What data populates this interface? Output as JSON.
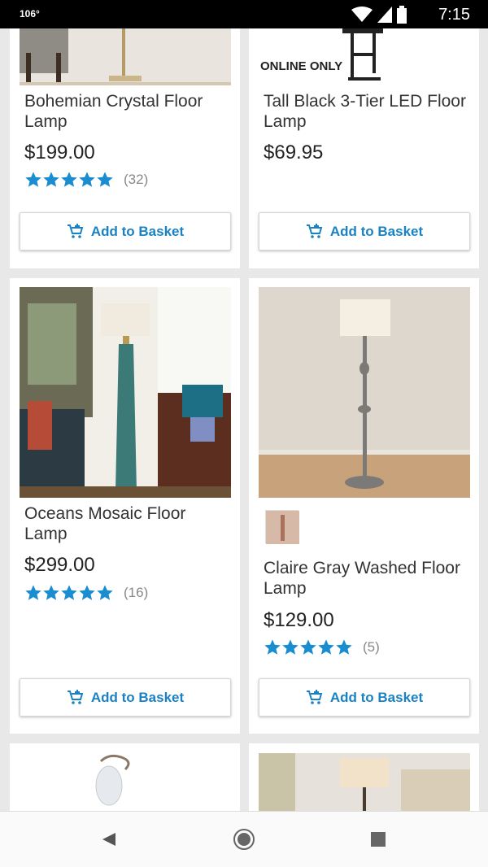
{
  "status": {
    "temp": "106°",
    "time": "7:15"
  },
  "online_label": "ONLINE ONLY",
  "add_label": "Add to Basket",
  "products": [
    {
      "title": "Bohemian Crystal Floor Lamp",
      "price": "$199.00",
      "reviews": "(32)",
      "rating": 5
    },
    {
      "title": "Tall Black 3-Tier LED Floor Lamp",
      "price": "$69.95",
      "reviews": "",
      "rating": 0
    },
    {
      "title": "Oceans Mosaic Floor Lamp",
      "price": "$299.00",
      "reviews": "(16)",
      "rating": 5
    },
    {
      "title": "Claire Gray Washed Floor Lamp",
      "price": "$129.00",
      "reviews": "(5)",
      "rating": 5
    }
  ],
  "colors": {
    "accent": "#1a82c4",
    "star": "#1a8dd0"
  }
}
